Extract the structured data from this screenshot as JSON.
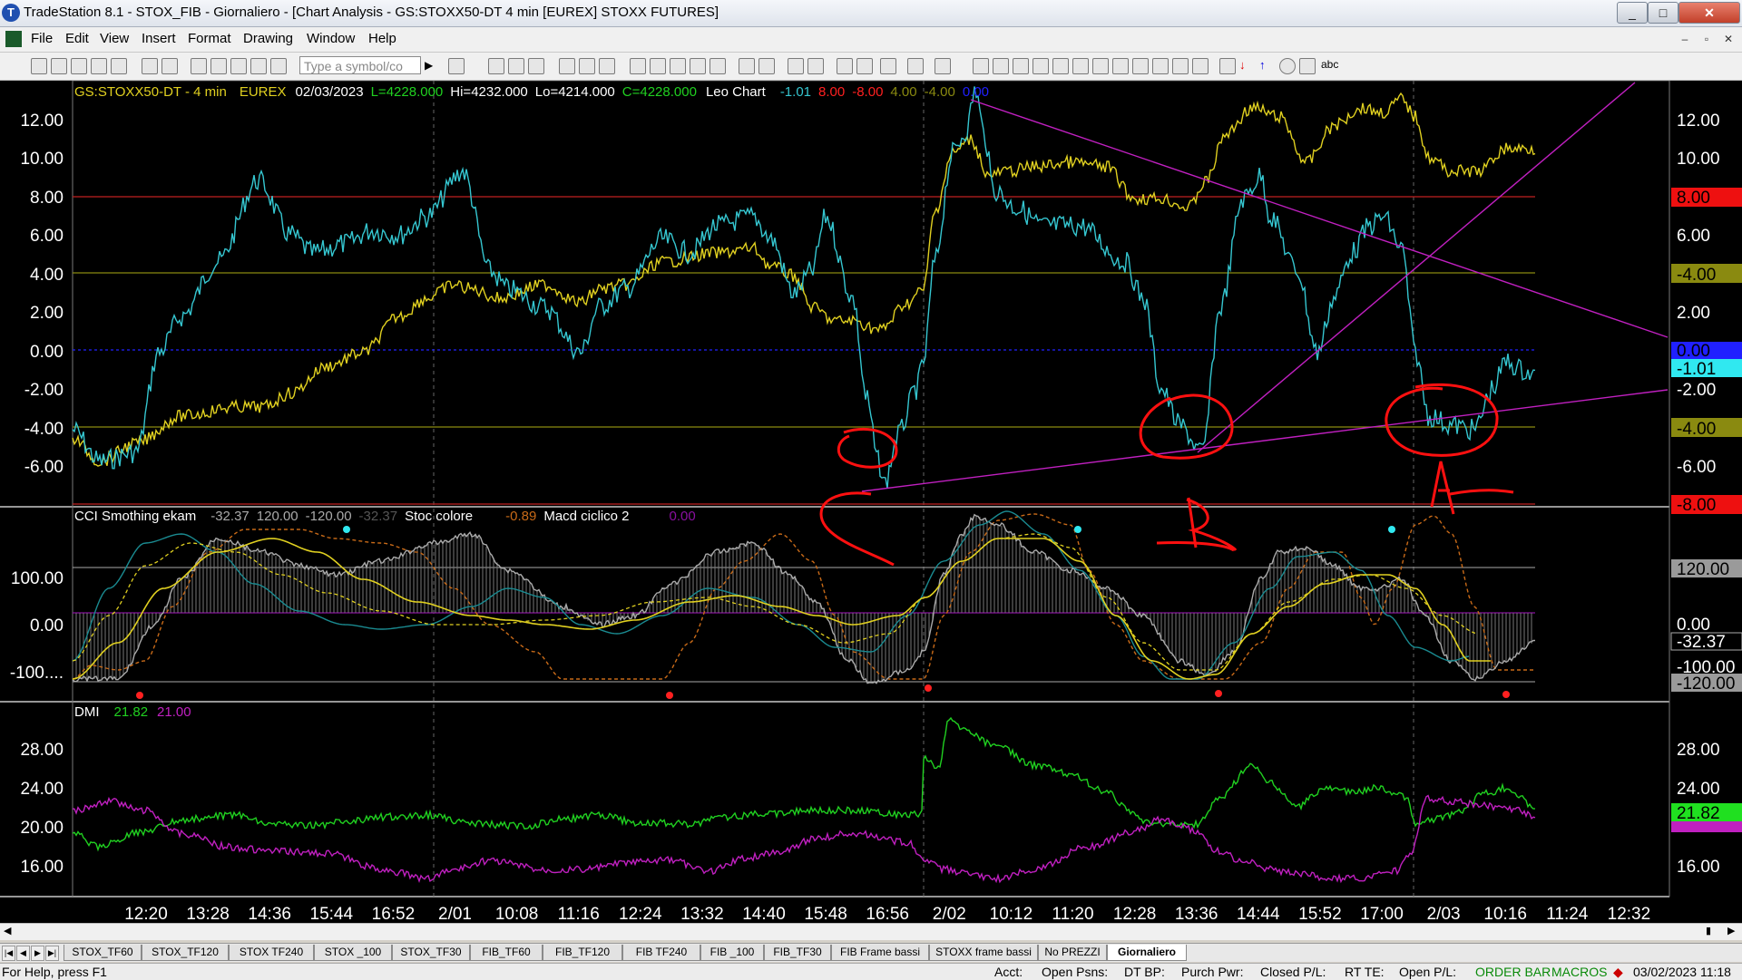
{
  "window": {
    "title": "TradeStation 8.1 - STOX_FIB - Giornaliero - [Chart Analysis - GS:STOXX50-DT  4 min  [EUREX] STOXX FUTURES]",
    "minimize": "_",
    "maximize": "□",
    "close": "✕"
  },
  "menu": {
    "items": [
      "File",
      "Edit",
      "View",
      "Insert",
      "Format",
      "Drawing",
      "Window",
      "Help"
    ],
    "mdi_min": "–",
    "mdi_restore": "▫",
    "mdi_close": "✕"
  },
  "toolbar": {
    "symbol_placeholder": "Type a symbol/co",
    "abc": "abc"
  },
  "header": {
    "symbol": "GS:STOXX50-DT - 4 min",
    "exchange": "EUREX",
    "date": "02/03/2023",
    "last": "L=4228.000",
    "high": "Hi=4232.000",
    "low": "Lo=4214.000",
    "close": "C=4228.000",
    "study": "Leo Chart",
    "v1": "-1.01",
    "v2": "8.00",
    "v3": "-8.00",
    "v4": "4.00",
    "v5": "-4.00",
    "v6": "0.00"
  },
  "panel1": {
    "y_ticks": [
      "12.00",
      "10.00",
      "8.00",
      "6.00",
      "4.00",
      "2.00",
      "0.00",
      "-2.00",
      "-4.00",
      "-6.00"
    ],
    "right_labels": [
      "12.00",
      "10.00",
      "8.00",
      "6.00",
      "4.00",
      "2.00",
      "0.00",
      "-1.01",
      "-2.00",
      "-4.00",
      "-6.00",
      "-8.00"
    ],
    "levels": {
      "upper": 8,
      "mid_upper": 4,
      "zero": 0,
      "mid_lower": -4,
      "lower": -8
    },
    "colors": {
      "cyan": "#35c6d0",
      "yellow": "#e0d020",
      "red": "#ff2020",
      "olive": "#8a8a10",
      "blue": "#2020ff",
      "magenta": "#c020c0"
    }
  },
  "panel2": {
    "legend": {
      "name": "CCI Smothing ekam",
      "v1": "-32.37",
      "v2": "120.00",
      "v3": "-120.00",
      "v4": "-32.37",
      "name2": "Stoc colore",
      "v5": "-0.89",
      "name3": "Macd ciclico 2",
      "v6": "0.00"
    },
    "y_ticks": [
      "100.00",
      "0.00",
      "-100...."
    ],
    "right_labels": [
      "120.00",
      "0.00",
      "-32.37",
      "-100.00",
      "-120.00"
    ]
  },
  "panel3": {
    "legend": {
      "name": "DMI",
      "v1": "21.82",
      "v2": "21.00"
    },
    "y_ticks": [
      "28.00",
      "24.00",
      "20.00",
      "16.00"
    ],
    "right_labels": [
      "28.00",
      "24.00",
      "21.82",
      "20.00",
      "16.00"
    ]
  },
  "time_axis": [
    "12:20",
    "13:28",
    "14:36",
    "15:44",
    "16:52",
    "2/01",
    "10:08",
    "11:16",
    "12:24",
    "13:32",
    "14:40",
    "15:48",
    "16:56",
    "2/02",
    "10:12",
    "11:20",
    "12:28",
    "13:36",
    "14:44",
    "15:52",
    "17:00",
    "2/03",
    "10:16",
    "11:24",
    "12:32"
  ],
  "tabs": [
    "STOX_TF60",
    "STOX_TF120",
    "STOX TF240",
    "STOX _100",
    "STOX_TF30",
    "FIB_TF60",
    "FIB_TF120",
    "FIB TF240",
    "FIB _100",
    "FIB_TF30",
    "FIB Frame bassi",
    "STOXX frame bassi",
    "No PREZZI",
    "Giornaliero"
  ],
  "status": {
    "help": "For Help, press F1",
    "acct": "Acct:",
    "open_psns": "Open Psns:",
    "dt_bp": "DT BP:",
    "purch_pwr": "Purch Pwr:",
    "closed_pl": "Closed P/L:",
    "rt_te": "RT TE:",
    "open_pl": "Open P/L:",
    "order_bar": "ORDER BAR",
    "macros": "MACROS",
    "datetime": "03/02/2023 11:18"
  }
}
